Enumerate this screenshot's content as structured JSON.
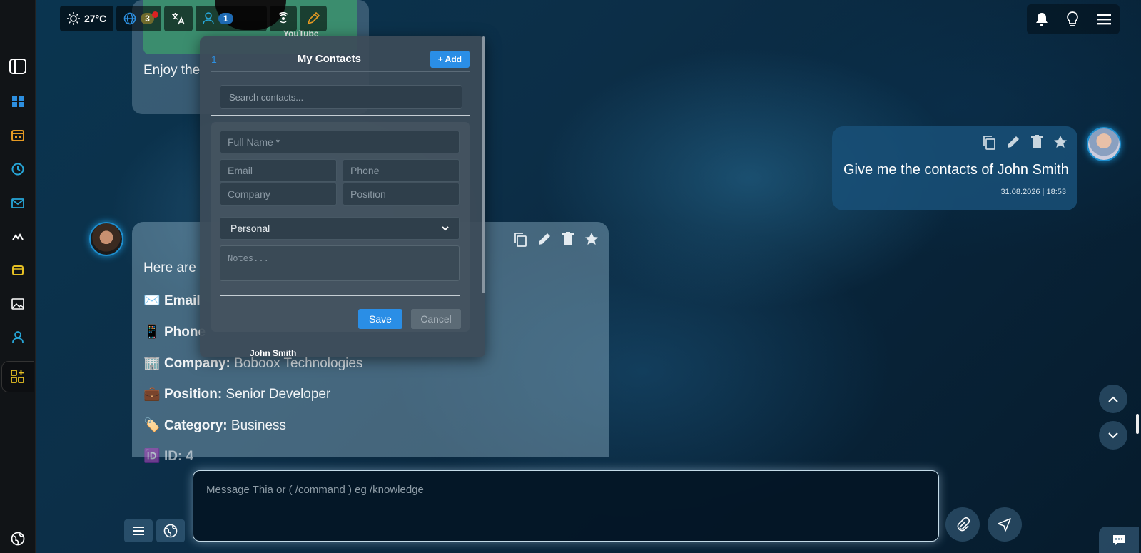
{
  "topbar": {
    "temperature": "27°C",
    "language_badge": "3",
    "users_badge": "1"
  },
  "card_top": {
    "text": "Enjoy the",
    "youtube_label": "YouTube"
  },
  "user_message": {
    "text": "Give me the contacts of John Smith",
    "timestamp": "31.08.2026 | 18:53"
  },
  "ai_message": {
    "intro": "Here are",
    "lines": [
      {
        "emoji": "✉️",
        "label": "Email",
        "value": ""
      },
      {
        "emoji": "📱",
        "label": "Phone",
        "value": ""
      },
      {
        "emoji": "🏢",
        "label": "Company:",
        "value": "Boboox Technologies"
      },
      {
        "emoji": "💼",
        "label": "Position:",
        "value": "Senior Developer"
      },
      {
        "emoji": "🏷️",
        "label": "Category:",
        "value": "Business"
      },
      {
        "emoji": "🆔",
        "label": "ID: 4",
        "value": ""
      }
    ]
  },
  "contacts_modal": {
    "count": "1",
    "title": "My Contacts",
    "add_label": "+ Add",
    "search_placeholder": "Search contacts...",
    "form": {
      "full_name_placeholder": "Full Name *",
      "email_placeholder": "Email",
      "phone_placeholder": "Phone",
      "company_placeholder": "Company",
      "position_placeholder": "Position",
      "category_selected": "Personal",
      "notes_placeholder": "Notes...",
      "save_label": "Save",
      "cancel_label": "Cancel"
    },
    "contact_name": "John Smith"
  },
  "composer": {
    "placeholder": "Message Thia or ( /command ) eg /knowledge"
  }
}
